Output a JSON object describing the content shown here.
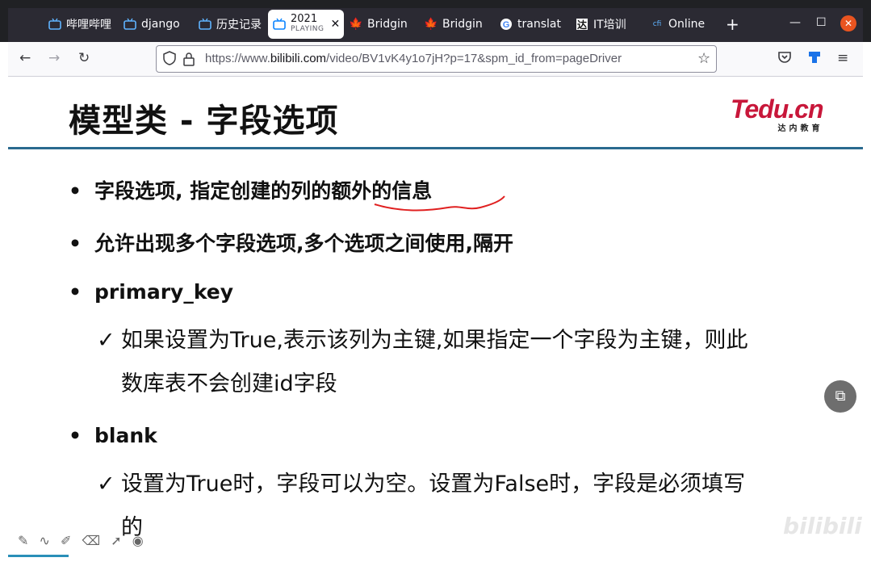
{
  "browser": {
    "tabs": [
      {
        "label": "哔哩哔哩",
        "icon": "bilibili-tv-icon"
      },
      {
        "label": "django",
        "icon": "bilibili-tv-icon"
      },
      {
        "label": "历史记录",
        "icon": "bilibili-tv-icon"
      },
      {
        "label": "2021",
        "sublabel": "PLAYING",
        "icon": "bilibili-tv-icon",
        "active": true
      },
      {
        "label": "Bridgin",
        "icon": "maple-leaf-icon"
      },
      {
        "label": "Bridgin",
        "icon": "maple-leaf-icon"
      },
      {
        "label": "translat",
        "icon": "google-icon"
      },
      {
        "label": "IT培训",
        "icon": "da-icon"
      },
      {
        "label": "Online",
        "icon": "cfi-icon"
      }
    ],
    "new_tab": "+",
    "url_prefix": "https://www.",
    "url_domain": "bilibili.com",
    "url_path": "/video/BV1vK4y1o7jH?p=17&spm_id_from=pageDriver"
  },
  "slide": {
    "title": "模型类 - 字段选项",
    "logo_main": "Tedu.cn",
    "logo_sub": "达内教育",
    "bullets": [
      "字段选项, 指定创建的列的额外的信息",
      "允许出现多个字段选项,多个选项之间使用,隔开",
      "primary_key",
      "blank"
    ],
    "primary_key_detail_line1": "如果设置为True,表示该列为主键,如果指定一个字段为主键，则此",
    "primary_key_detail_line2": "数库表不会创建id字段",
    "blank_detail_line1": "设置为True时，字段可以为空。设置为False时，字段是必须填写",
    "blank_detail_line2": "的",
    "bullet_char": "•",
    "tick_char": "✓"
  },
  "watermark": "bilibili"
}
